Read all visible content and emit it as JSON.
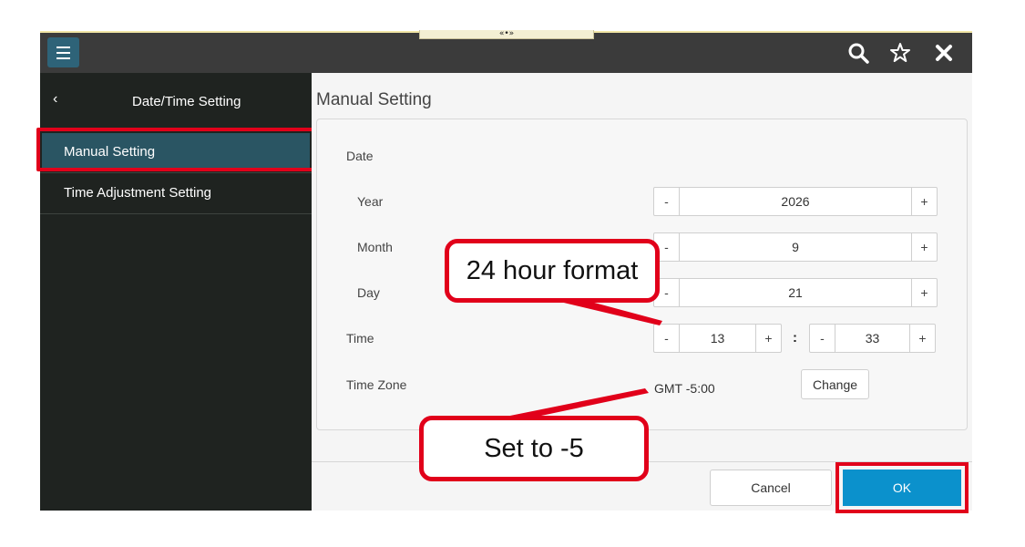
{
  "topbar": {
    "grip_glyph": "«•»",
    "icons": [
      "menu-icon",
      "search-icon",
      "star-icon",
      "close-icon"
    ]
  },
  "sidebar": {
    "title": "Date/Time Setting",
    "items": [
      {
        "label": "Manual Setting",
        "active": true
      },
      {
        "label": "Time Adjustment Setting",
        "active": false
      }
    ]
  },
  "main": {
    "title": "Manual Setting",
    "date_label": "Date",
    "year": {
      "label": "Year",
      "value": "2026"
    },
    "month": {
      "label": "Month",
      "value": "9"
    },
    "day": {
      "label": "Day",
      "value": "21"
    },
    "time": {
      "label": "Time",
      "hour": "13",
      "minute": "33",
      "separator": ":"
    },
    "timezone": {
      "label": "Time Zone",
      "value": "GMT -5:00",
      "change_label": "Change"
    },
    "stepper": {
      "minus": "-",
      "plus": "+"
    }
  },
  "footer": {
    "cancel_label": "Cancel",
    "ok_label": "OK"
  },
  "annotations": {
    "hour_format_note": "24 hour format",
    "timezone_note": "Set to -5",
    "highlight_color": "#e1001a"
  },
  "colors": {
    "accent": "#0b91cc",
    "sidebar_bg": "#1f2320",
    "sidebar_active": "#2a5563",
    "topbar_bg": "#3b3b3b"
  }
}
